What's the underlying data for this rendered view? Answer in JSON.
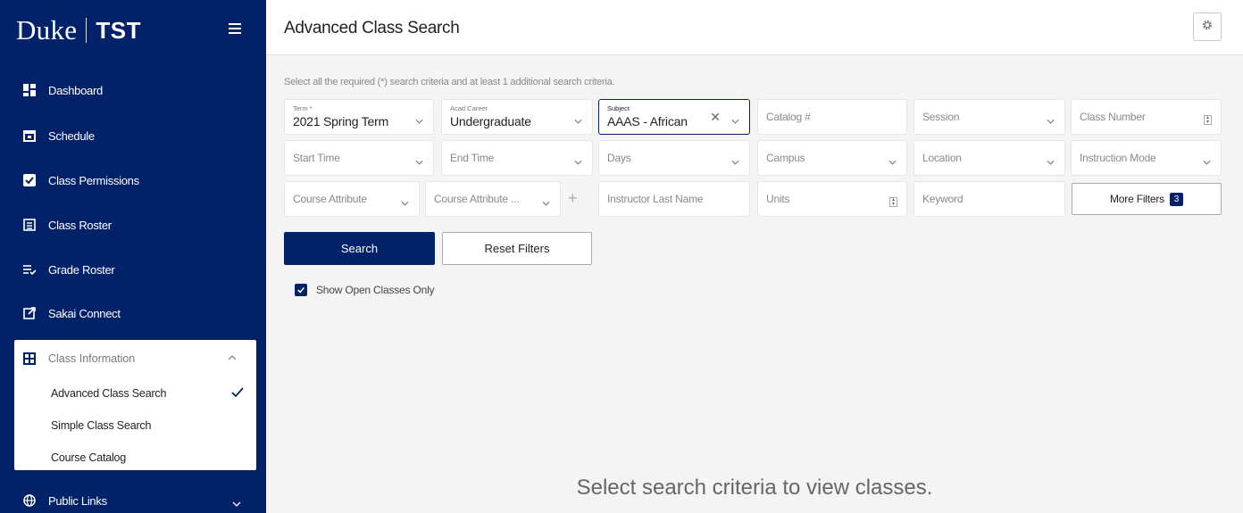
{
  "brand": {
    "name": "Duke",
    "env": "TST"
  },
  "sidebar": {
    "items": [
      {
        "label": "Dashboard",
        "icon": "dashboard-icon"
      },
      {
        "label": "Schedule",
        "icon": "calendar-icon"
      },
      {
        "label": "Class Permissions",
        "icon": "checkbox-icon"
      },
      {
        "label": "Class Roster",
        "icon": "roster-icon"
      },
      {
        "label": "Grade Roster",
        "icon": "grade-list-icon"
      },
      {
        "label": "Sakai Connect",
        "icon": "external-link-icon"
      }
    ],
    "class_info": {
      "label": "Class Information",
      "icon": "grid-icon",
      "subitems": [
        "Advanced Class Search",
        "Simple Class Search",
        "Course Catalog"
      ],
      "active": "Advanced Class Search"
    },
    "public_links": {
      "label": "Public Links",
      "icon": "globe-icon"
    }
  },
  "header": {
    "title": "Advanced Class Search"
  },
  "main": {
    "instructions": "Select all the required (*) search criteria and at least 1 additional search criteria.",
    "fields": {
      "term": {
        "label": "Term *",
        "value": "2021 Spring Term"
      },
      "career": {
        "label": "Acad Career",
        "value": "Undergraduate"
      },
      "subject": {
        "label": "Subject",
        "value": "AAAS - African"
      },
      "catalog": "Catalog #",
      "session": "Session",
      "class_number": "Class Number",
      "start_time": "Start Time",
      "end_time": "End Time",
      "days": "Days",
      "campus": "Campus",
      "location": "Location",
      "instruction_mode": "Instruction Mode",
      "course_attr": "Course Attribute",
      "course_attr_value": "Course Attribute ...",
      "instructor": "Instructor Last Name",
      "units": "Units",
      "keyword": "Keyword"
    },
    "more_filters": {
      "label": "More Filters",
      "count": "3"
    },
    "search_label": "Search",
    "reset_label": "Reset Filters",
    "open_only": {
      "label": "Show Open Classes Only",
      "checked": true
    },
    "empty_message": "Select search criteria to view classes."
  },
  "colors": {
    "primary": "#012169",
    "background": "#f4f4f4"
  }
}
